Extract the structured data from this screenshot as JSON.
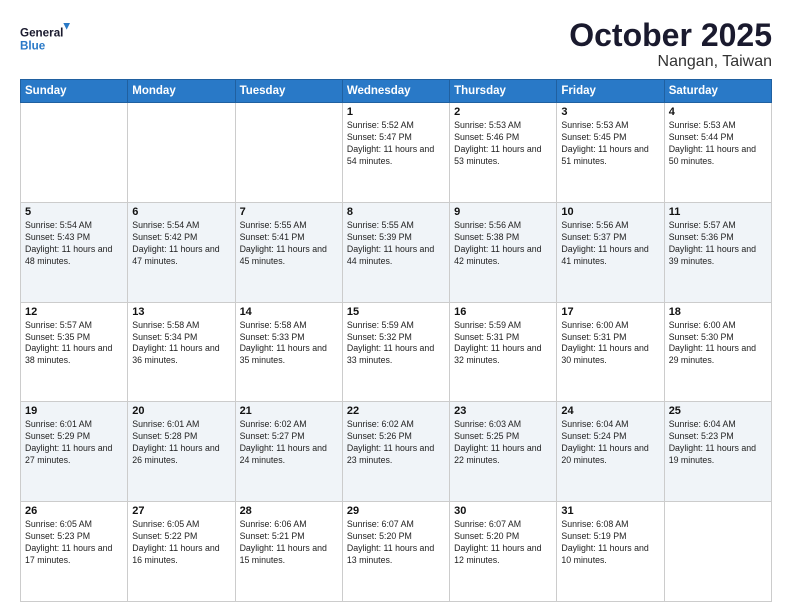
{
  "header": {
    "logo_line1": "General",
    "logo_line2": "Blue",
    "month": "October 2025",
    "location": "Nangan, Taiwan"
  },
  "days_header": [
    "Sunday",
    "Monday",
    "Tuesday",
    "Wednesday",
    "Thursday",
    "Friday",
    "Saturday"
  ],
  "weeks": [
    [
      {
        "day": "",
        "text": ""
      },
      {
        "day": "",
        "text": ""
      },
      {
        "day": "",
        "text": ""
      },
      {
        "day": "1",
        "text": "Sunrise: 5:52 AM\nSunset: 5:47 PM\nDaylight: 11 hours and 54 minutes."
      },
      {
        "day": "2",
        "text": "Sunrise: 5:53 AM\nSunset: 5:46 PM\nDaylight: 11 hours and 53 minutes."
      },
      {
        "day": "3",
        "text": "Sunrise: 5:53 AM\nSunset: 5:45 PM\nDaylight: 11 hours and 51 minutes."
      },
      {
        "day": "4",
        "text": "Sunrise: 5:53 AM\nSunset: 5:44 PM\nDaylight: 11 hours and 50 minutes."
      }
    ],
    [
      {
        "day": "5",
        "text": "Sunrise: 5:54 AM\nSunset: 5:43 PM\nDaylight: 11 hours and 48 minutes."
      },
      {
        "day": "6",
        "text": "Sunrise: 5:54 AM\nSunset: 5:42 PM\nDaylight: 11 hours and 47 minutes."
      },
      {
        "day": "7",
        "text": "Sunrise: 5:55 AM\nSunset: 5:41 PM\nDaylight: 11 hours and 45 minutes."
      },
      {
        "day": "8",
        "text": "Sunrise: 5:55 AM\nSunset: 5:39 PM\nDaylight: 11 hours and 44 minutes."
      },
      {
        "day": "9",
        "text": "Sunrise: 5:56 AM\nSunset: 5:38 PM\nDaylight: 11 hours and 42 minutes."
      },
      {
        "day": "10",
        "text": "Sunrise: 5:56 AM\nSunset: 5:37 PM\nDaylight: 11 hours and 41 minutes."
      },
      {
        "day": "11",
        "text": "Sunrise: 5:57 AM\nSunset: 5:36 PM\nDaylight: 11 hours and 39 minutes."
      }
    ],
    [
      {
        "day": "12",
        "text": "Sunrise: 5:57 AM\nSunset: 5:35 PM\nDaylight: 11 hours and 38 minutes."
      },
      {
        "day": "13",
        "text": "Sunrise: 5:58 AM\nSunset: 5:34 PM\nDaylight: 11 hours and 36 minutes."
      },
      {
        "day": "14",
        "text": "Sunrise: 5:58 AM\nSunset: 5:33 PM\nDaylight: 11 hours and 35 minutes."
      },
      {
        "day": "15",
        "text": "Sunrise: 5:59 AM\nSunset: 5:32 PM\nDaylight: 11 hours and 33 minutes."
      },
      {
        "day": "16",
        "text": "Sunrise: 5:59 AM\nSunset: 5:31 PM\nDaylight: 11 hours and 32 minutes."
      },
      {
        "day": "17",
        "text": "Sunrise: 6:00 AM\nSunset: 5:31 PM\nDaylight: 11 hours and 30 minutes."
      },
      {
        "day": "18",
        "text": "Sunrise: 6:00 AM\nSunset: 5:30 PM\nDaylight: 11 hours and 29 minutes."
      }
    ],
    [
      {
        "day": "19",
        "text": "Sunrise: 6:01 AM\nSunset: 5:29 PM\nDaylight: 11 hours and 27 minutes."
      },
      {
        "day": "20",
        "text": "Sunrise: 6:01 AM\nSunset: 5:28 PM\nDaylight: 11 hours and 26 minutes."
      },
      {
        "day": "21",
        "text": "Sunrise: 6:02 AM\nSunset: 5:27 PM\nDaylight: 11 hours and 24 minutes."
      },
      {
        "day": "22",
        "text": "Sunrise: 6:02 AM\nSunset: 5:26 PM\nDaylight: 11 hours and 23 minutes."
      },
      {
        "day": "23",
        "text": "Sunrise: 6:03 AM\nSunset: 5:25 PM\nDaylight: 11 hours and 22 minutes."
      },
      {
        "day": "24",
        "text": "Sunrise: 6:04 AM\nSunset: 5:24 PM\nDaylight: 11 hours and 20 minutes."
      },
      {
        "day": "25",
        "text": "Sunrise: 6:04 AM\nSunset: 5:23 PM\nDaylight: 11 hours and 19 minutes."
      }
    ],
    [
      {
        "day": "26",
        "text": "Sunrise: 6:05 AM\nSunset: 5:23 PM\nDaylight: 11 hours and 17 minutes."
      },
      {
        "day": "27",
        "text": "Sunrise: 6:05 AM\nSunset: 5:22 PM\nDaylight: 11 hours and 16 minutes."
      },
      {
        "day": "28",
        "text": "Sunrise: 6:06 AM\nSunset: 5:21 PM\nDaylight: 11 hours and 15 minutes."
      },
      {
        "day": "29",
        "text": "Sunrise: 6:07 AM\nSunset: 5:20 PM\nDaylight: 11 hours and 13 minutes."
      },
      {
        "day": "30",
        "text": "Sunrise: 6:07 AM\nSunset: 5:20 PM\nDaylight: 11 hours and 12 minutes."
      },
      {
        "day": "31",
        "text": "Sunrise: 6:08 AM\nSunset: 5:19 PM\nDaylight: 11 hours and 10 minutes."
      },
      {
        "day": "",
        "text": ""
      }
    ]
  ]
}
